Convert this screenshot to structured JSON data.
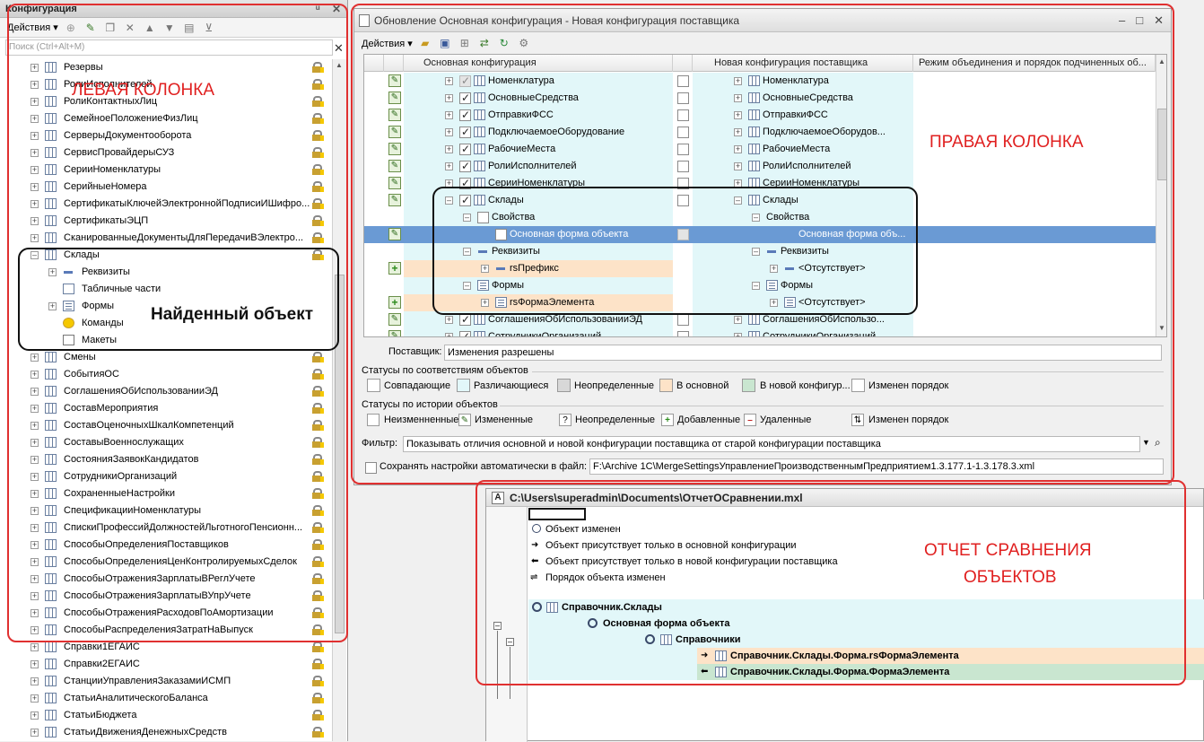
{
  "left_panel": {
    "title": "Конфигурация",
    "actions_label": "Действия",
    "search_placeholder": "Поиск (Ctrl+Alt+M)",
    "items": [
      {
        "label": "Резервы"
      },
      {
        "label": "РолиИсполнителей"
      },
      {
        "label": "РолиКонтактныхЛиц"
      },
      {
        "label": "СемейноеПоложениеФизЛиц"
      },
      {
        "label": "СерверыДокументооборота"
      },
      {
        "label": "СервисПровайдерыСУЗ"
      },
      {
        "label": "СерииНоменклатуры"
      },
      {
        "label": "СерийныеНомера"
      },
      {
        "label": "СертификатыКлючейЭлектроннойПодписиИШифро..."
      },
      {
        "label": "СертификатыЭЦП"
      },
      {
        "label": "СканированныеДокументыДляПередачиВЭлектро..."
      },
      {
        "label": "Склады"
      },
      {
        "label": "Реквизиты"
      },
      {
        "label": "Табличные части"
      },
      {
        "label": "Формы"
      },
      {
        "label": "Команды"
      },
      {
        "label": "Макеты"
      },
      {
        "label": "Смены"
      },
      {
        "label": "СобытияОС"
      },
      {
        "label": "СоглашенияОбИспользованииЭД"
      },
      {
        "label": "СоставМероприятия"
      },
      {
        "label": "СоставОценочныхШкалКомпетенций"
      },
      {
        "label": "СоставыВоеннослужащих"
      },
      {
        "label": "СостоянияЗаявокКандидатов"
      },
      {
        "label": "СотрудникиОрганизаций"
      },
      {
        "label": "СохраненныеНастройки"
      },
      {
        "label": "СпецификацииНоменклатуры"
      },
      {
        "label": "СпискиПрофессийДолжностейЛьготногоПенсионн..."
      },
      {
        "label": "СпособыОпределенияПоставщиков"
      },
      {
        "label": "СпособыОпределенияЦенКонтролируемыхСделок"
      },
      {
        "label": "СпособыОтраженияЗарплатыВРеглУчете"
      },
      {
        "label": "СпособыОтраженияЗарплатыВУпрУчете"
      },
      {
        "label": "СпособыОтраженияРасходовПоАмортизации"
      },
      {
        "label": "СпособыРаспределенияЗатратНаВыпуск"
      },
      {
        "label": "Справки1ЕГАИС"
      },
      {
        "label": "Справки2ЕГАИС"
      },
      {
        "label": "СтанцииУправленияЗаказамиИСМП"
      },
      {
        "label": "СтатьиАналитическогоБаланса"
      },
      {
        "label": "СтатьиБюджета"
      },
      {
        "label": "СтатьиДвиженияДенежныхСредств"
      }
    ]
  },
  "main_window": {
    "title": "Обновление Основная конфигурация - Новая конфигурация поставщика",
    "actions_label": "Действия",
    "columns": {
      "main": "Основная конфигурация",
      "vendor": "Новая конфигурация поставщика",
      "mode": "Режим объединения и порядок подчиненных об..."
    },
    "rows": [
      {
        "left": "Номенклатура",
        "right": "Номенклатура"
      },
      {
        "left": "ОсновныеСредства",
        "right": "ОсновныеСредства"
      },
      {
        "left": "ОтправкиФСС",
        "right": "ОтправкиФСС"
      },
      {
        "left": "ПодключаемоеОборудование",
        "right": "ПодключаемоеОборудов..."
      },
      {
        "left": "РабочиеМеста",
        "right": "РабочиеМеста"
      },
      {
        "left": "РолиИсполнителей",
        "right": "РолиИсполнителей"
      },
      {
        "left": "СерииНоменклатуры",
        "right": "СерииНоменклатуры"
      },
      {
        "left": "Склады",
        "right": "Склады"
      },
      {
        "left": "Свойства",
        "right": "Свойства"
      },
      {
        "left": "Основная форма объекта",
        "right": "Основная форма объ..."
      },
      {
        "left": "Реквизиты",
        "right": "Реквизиты"
      },
      {
        "left": "rsПрефикс",
        "right": "<Отсутствует>"
      },
      {
        "left": "Формы",
        "right": "Формы"
      },
      {
        "left": "rsФормаЭлемента",
        "right": "<Отсутствует>"
      },
      {
        "left": "СоглашенияОбИспользованииЭД",
        "right": "СоглашенияОбИспользо..."
      },
      {
        "left": "СотрудникиОрганизаций",
        "right": "СотрудникиОрганизаций"
      }
    ],
    "vendor_label": "Поставщик:",
    "vendor_value": "Изменения разрешены",
    "status_match_title": "Статусы по соответствиям объектов",
    "status_match": {
      "same": "Совпадающие",
      "diff": "Различающиеся",
      "undef": "Неопределенные",
      "in_main": "В основной",
      "in_new": "В новой конфигур...",
      "order": "Изменен порядок"
    },
    "status_history_title": "Статусы по истории объектов",
    "status_history": {
      "unchanged": "Неизменненные",
      "changed": "Измененные",
      "undef": "Неопределенные",
      "added": "Добавленные",
      "deleted": "Удаленные",
      "order": "Изменен порядок"
    },
    "filter_label": "Фильтр:",
    "filter_value": "Показывать отличия основной и новой конфигурации поставщика от старой конфигурации поставщика",
    "autosave_label": "Сохранять настройки автоматически в файл:",
    "autosave_path": "F:\\Archive 1C\\MergeSettingsУправлениеПроизводственнымПредприятием1.3.177.1-1.3.178.3.xml"
  },
  "report_window": {
    "title": "C:\\Users\\superadmin\\Documents\\ОтчетОСравнении.mxl",
    "legend": [
      "Объект изменен",
      "Объект присутствует только в основной конфигурации",
      "Объект присутствует только в новой конфигурации поставщика",
      "Порядок объекта изменен"
    ],
    "tree": [
      "Справочник.Склады",
      "Основная форма объекта",
      "Справочники",
      "Справочник.Склады.Форма.rsФормаЭлемента",
      "Справочник.Склады.Форма.ФормаЭлемента"
    ]
  },
  "annotations": {
    "left_column": "ЛЕВАЯ КОЛОНКА",
    "right_column": "ПРАВАЯ КОЛОНКА",
    "found_object": "Найденный объект",
    "report_line1": "ОТЧЕТ СРАВНЕНИЯ",
    "report_line2": "ОБЪЕКТОВ"
  },
  "colors": {
    "cyan": "#e2f7f9",
    "orange": "#fde3c8",
    "green": "#c9e6d0",
    "selection": "#6a9ad4",
    "annotation_red": "#e03030"
  }
}
